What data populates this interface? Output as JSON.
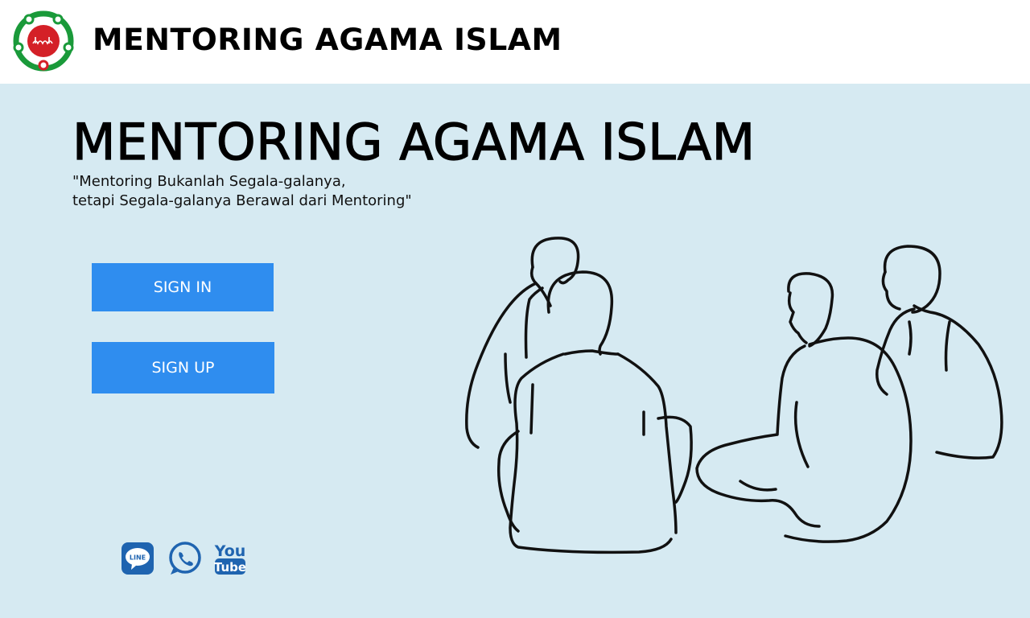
{
  "header": {
    "title": "MENTORING AGAMA ISLAM",
    "logo_icon": "islam-circle-logo-icon"
  },
  "hero": {
    "title": "MENTORING AGAMA ISLAM",
    "tagline_line1": "\"Mentoring Bukanlah Segala-galanya,",
    "tagline_line2": "tetapi Segala-galanya Berawal dari Mentoring\""
  },
  "actions": {
    "signin_label": "SIGN IN",
    "signup_label": "SIGN UP"
  },
  "social": {
    "line_label": "LINE",
    "youtube_label_top": "You",
    "youtube_label_bottom": "Tube",
    "icons": [
      "line-icon",
      "whatsapp-icon",
      "youtube-icon"
    ]
  },
  "colors": {
    "accent_button": "#2f8def",
    "main_background": "#d6eaf2",
    "social_icon": "#1f64b0",
    "logo_green": "#1a9a3a",
    "logo_red": "#d42027"
  }
}
